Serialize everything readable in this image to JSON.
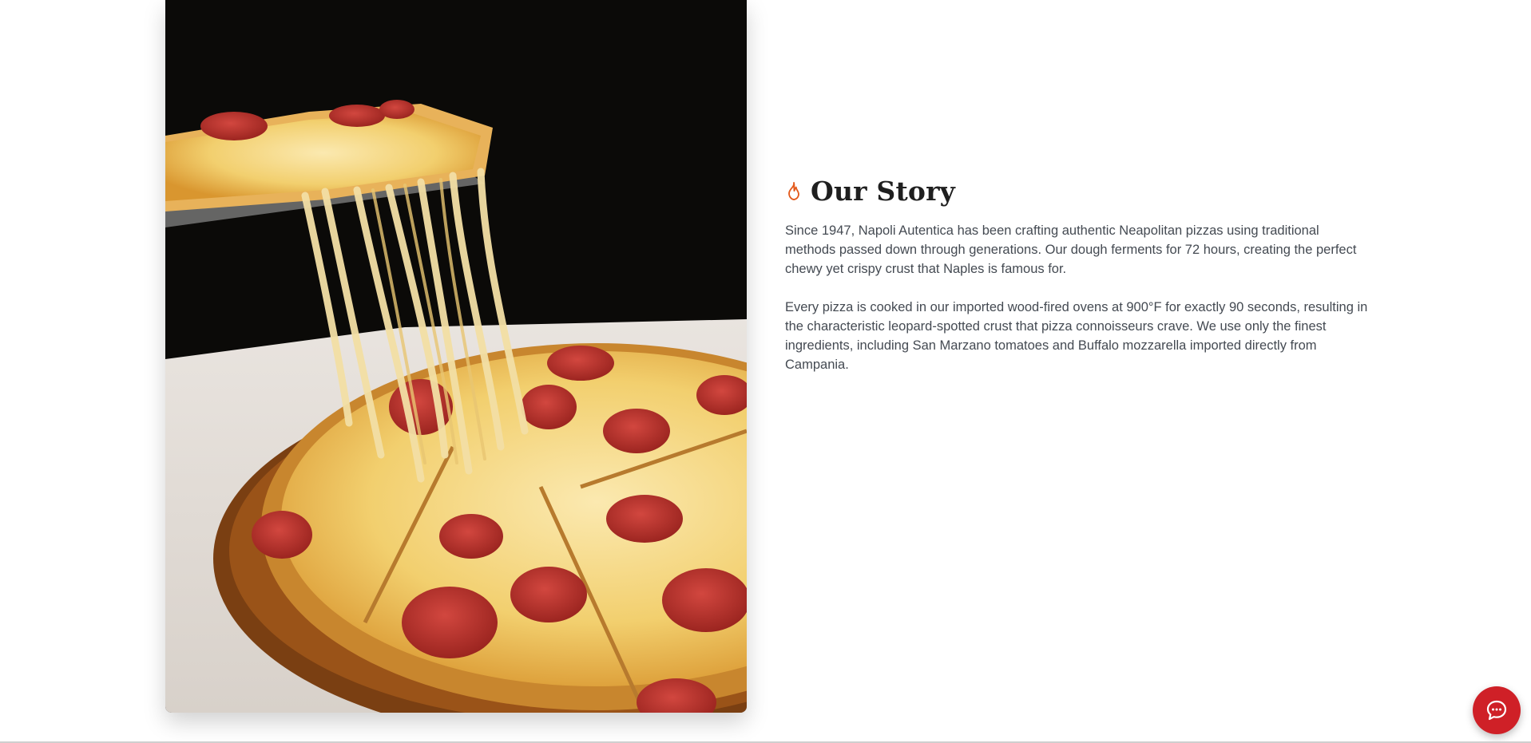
{
  "story": {
    "title": "Our Story",
    "title_icon": "flame-icon",
    "paragraphs": [
      "Since 1947, Napoli Autentica has been crafting authentic Neapolitan pizzas using traditional methods passed down through generations. Our dough ferments for 72 hours, creating the perfect chewy yet crispy crust that Naples is famous for.",
      "Every pizza is cooked in our imported wood-fired ovens at 900°F for exactly 90 seconds, resulting in the characteristic leopard-spotted crust that pizza connoisseurs crave. We use only the finest ingredients, including San Marzano tomatoes and Buffalo mozzarella imported directly from Campania."
    ]
  },
  "image": {
    "subject": "pepperoni-pizza-slice-cheese-pull-photo"
  },
  "chat": {
    "icon": "chat-bubble-icon"
  },
  "colors": {
    "accent": "#cf2027",
    "flame": "#e35a1c",
    "body_text": "#444a52",
    "heading": "#1f1f1f"
  }
}
